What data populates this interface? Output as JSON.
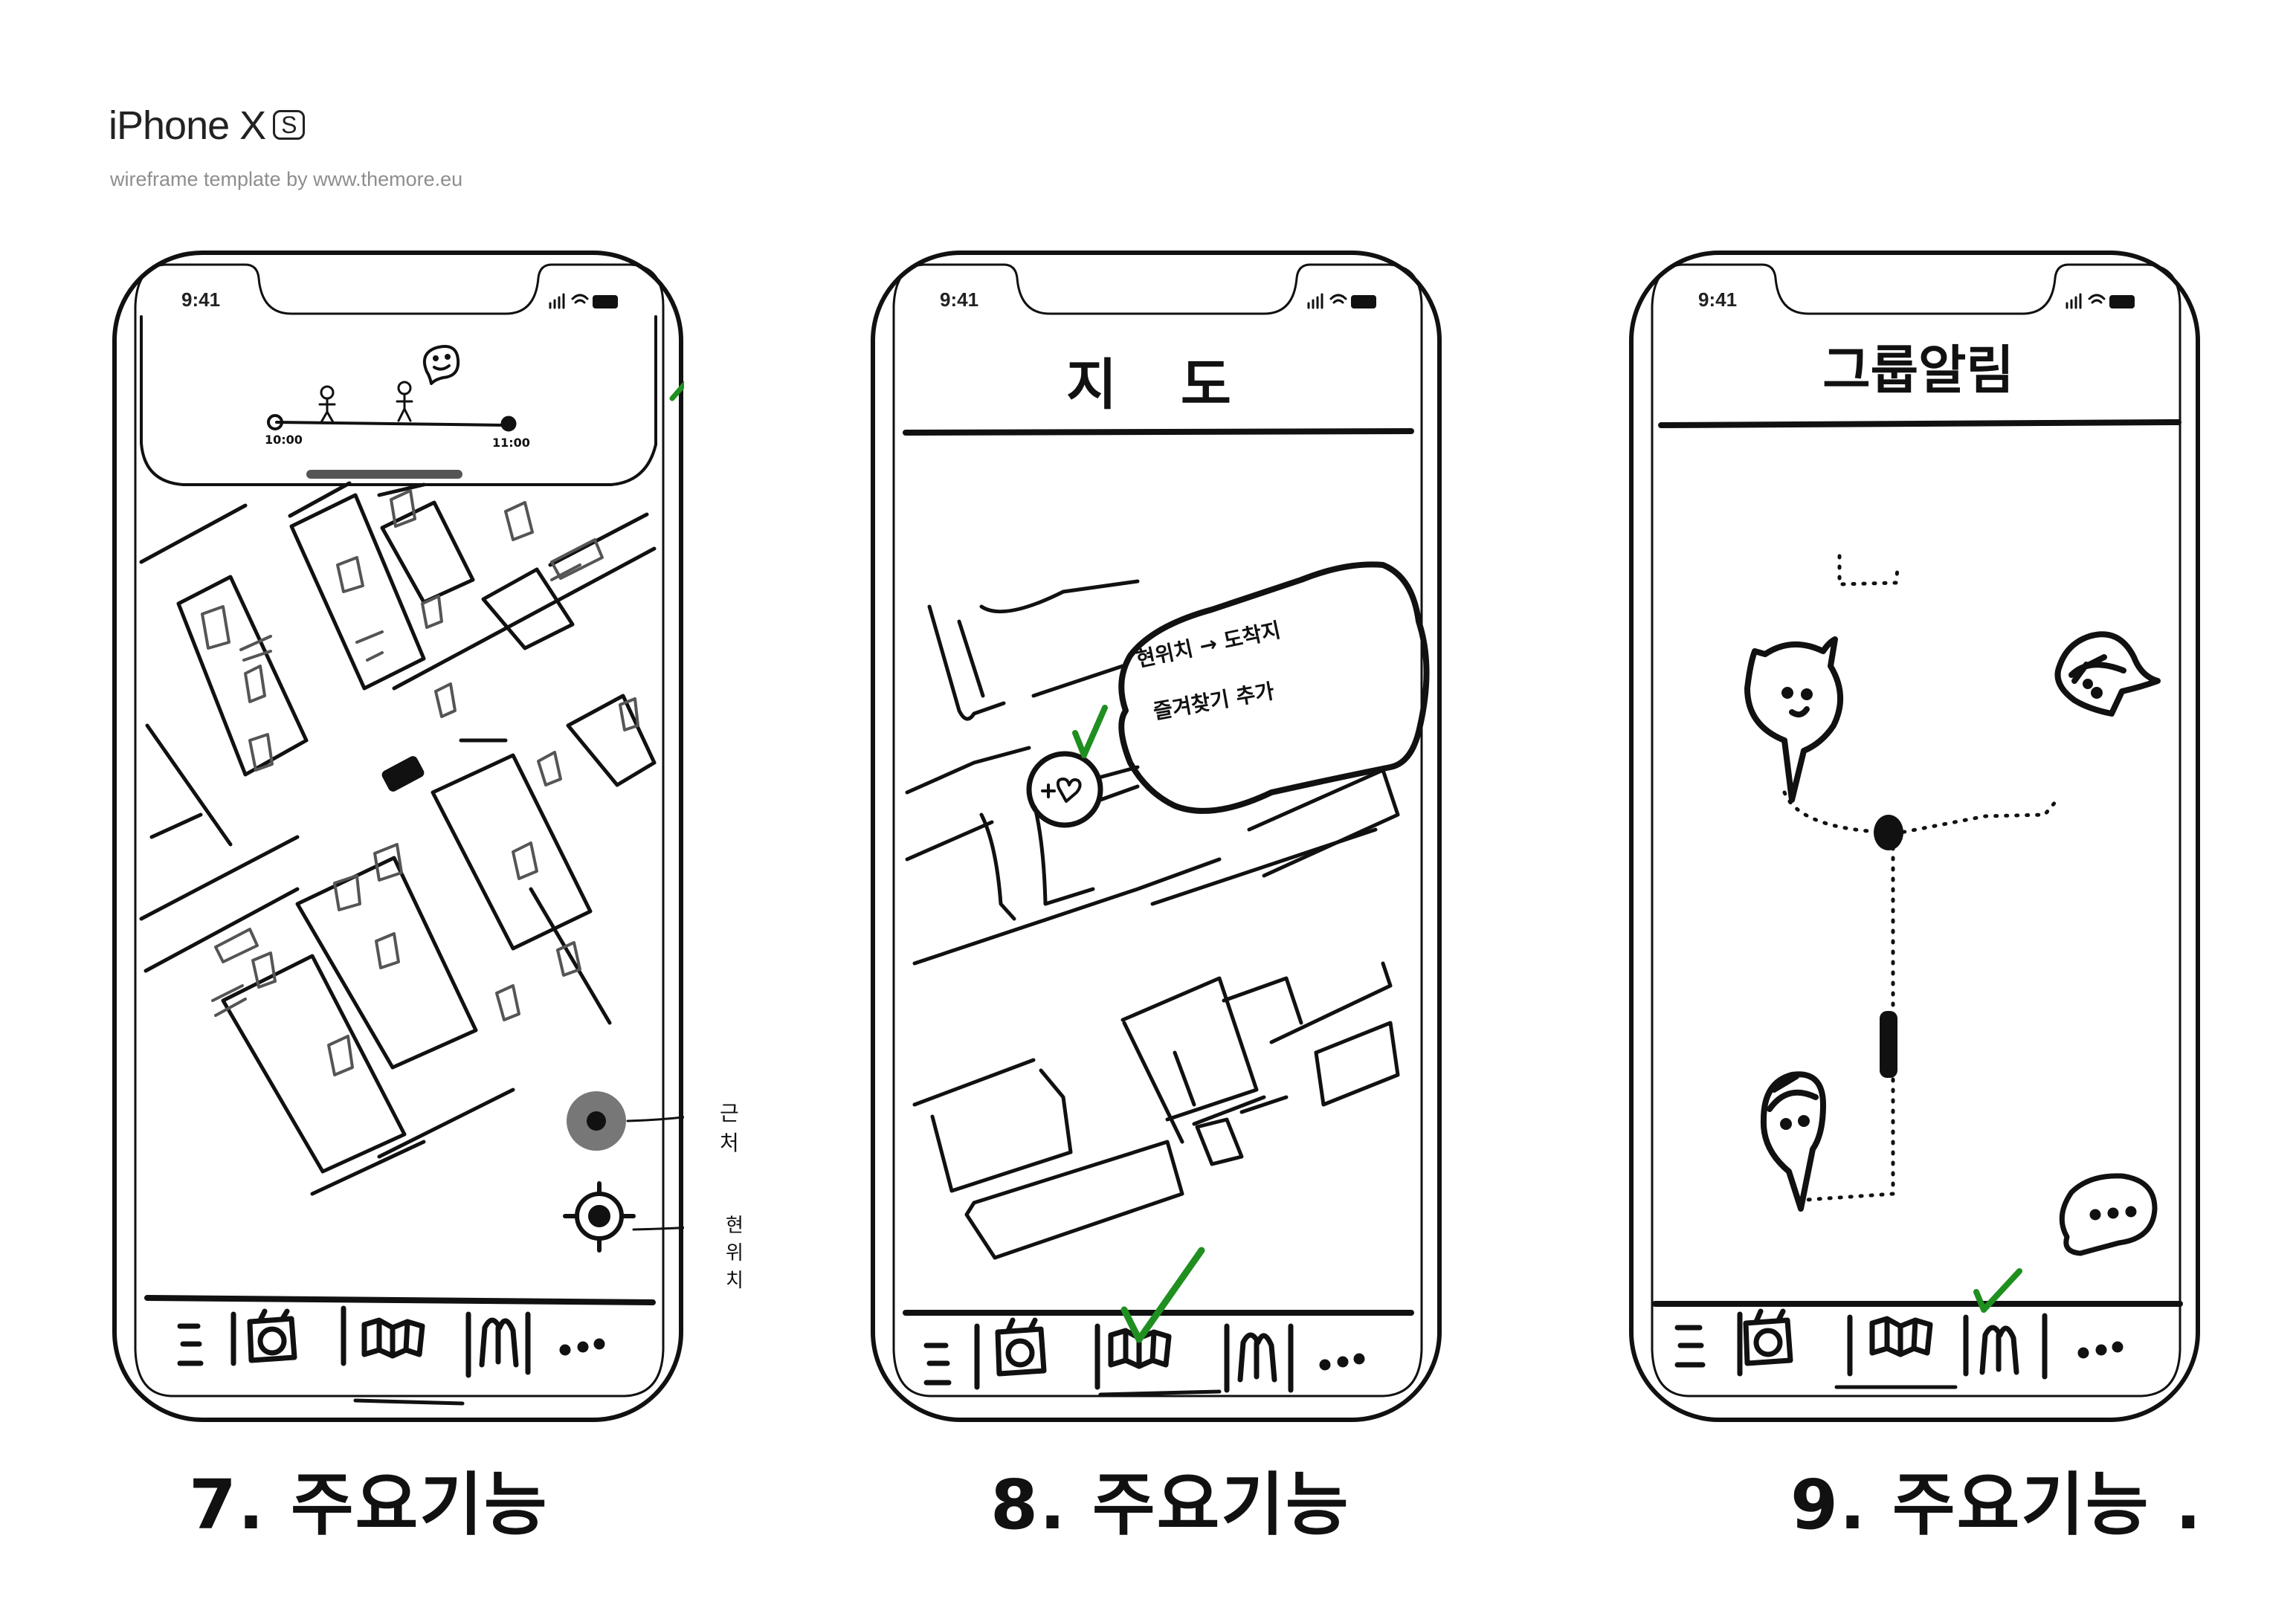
{
  "header": {
    "title": "iPhone X",
    "badge": "S",
    "subtitle": "wireframe template by www.themore.eu"
  },
  "phones": [
    {
      "status_time": "9:41",
      "timeline": {
        "start_time": "10:00",
        "end_time": "11:00"
      },
      "buttons": {
        "nearby_label": "근처",
        "current_location_label": "현위치"
      },
      "caption": "7. 주요기능"
    },
    {
      "status_time": "9:41",
      "title": "지 도",
      "bubble": {
        "line1": "현위치 → 도착지",
        "line2": "즐겨찾기 추가"
      },
      "caption": "8. 주요기능"
    },
    {
      "status_time": "9:41",
      "title": "그룹알림",
      "caption": "9. 주요기능 ."
    }
  ],
  "tabbar": [
    {
      "icon": "menu-icon"
    },
    {
      "icon": "camera-icon"
    },
    {
      "icon": "map-icon"
    },
    {
      "icon": "group-icon"
    },
    {
      "icon": "more-icon"
    }
  ],
  "colors": {
    "ink": "#111111",
    "annotation_green": "#1f8f1f",
    "button_gray": "#777777"
  }
}
